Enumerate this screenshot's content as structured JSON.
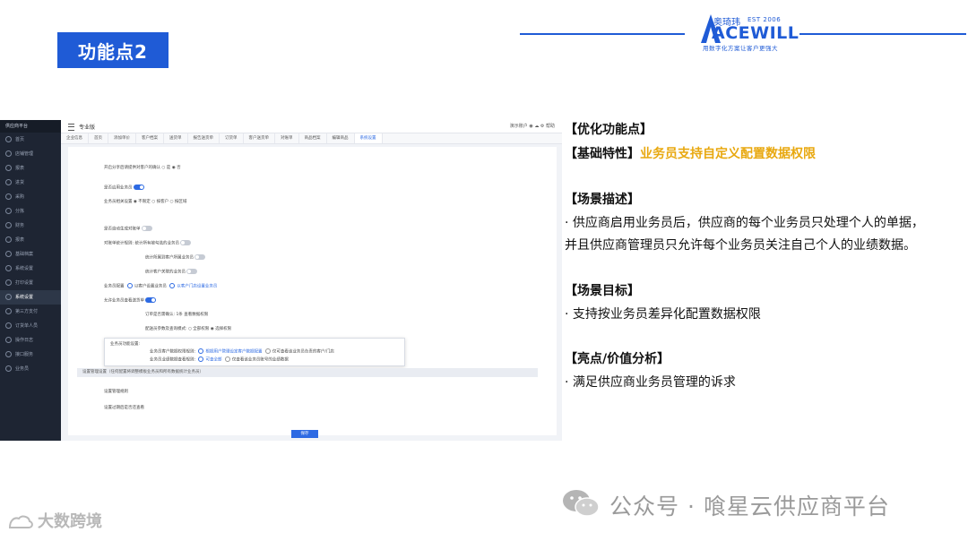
{
  "slide": {
    "title": "功能点2"
  },
  "logo": {
    "cn": "奥琦玮",
    "est": "EST 2006",
    "word": "ACEWILL",
    "tagline": "用数字化方案让客户更强大"
  },
  "screenshot": {
    "sidebar_brand": "供应商平台",
    "sidebar_items": [
      "首页",
      "店铺管理",
      "报表",
      "进货",
      "采购",
      "分拣",
      "财务",
      "报表",
      "基础档案",
      "系统设置",
      "打印设置",
      "系统设置",
      "第三方支付",
      "订货单人员",
      "操作日志",
      "接口服务",
      "业务员"
    ],
    "topbar_title": "专业版",
    "topbar_right": "演示账户 ◉ ☁ ⚙ 帮助",
    "tabs": [
      "企业信息",
      "首页",
      "添加单价",
      "客户档案",
      "送货单",
      "报告送货单",
      "订货单",
      "客户送货单",
      "对账单",
      "商品档案",
      "编辑商品",
      "系统设置"
    ],
    "rows": {
      "r1": "开启分享后请提供对客户的确认 ○ 是 ◉ 否",
      "r2": "是否启用业务员",
      "r3": "业务员相关设置  ◉ 不限定  ○ 按客户  ○ 按区域",
      "r4": "是否自动生成对账单",
      "r5": "对账单统计规则: 统计所有被勾选的业务员",
      "r6": "统计所属到客户所属业务员",
      "r7": "统计客户关联的业务员",
      "r8": "业务员配置",
      "r8b": "以客户设置业务员",
      "r8c": "以客户门店设置业务员",
      "r9": "允许业务员查看送货单",
      "r10": "订单是否需确认: 1条 查看数据权限",
      "r11": "配送员参数及查询模式: ○ 全部权限  ◉ 选择权限"
    },
    "popup": {
      "title": "业务员功能设置:",
      "row1_label": "业务员客户数据权限规则:",
      "row1_opt1": "根据用户管理设定客户数据配置",
      "row1_opt2": "仅可查看该业务员负责的客户/门店",
      "row2_label": "业务员业绩数据查看规则:",
      "row2_opt1": "可查全部",
      "row2_opt2": "仅查看该业务员账号的业绩数据"
    },
    "graybar": "设置管理设置（任何配置将调整模板业务员和所有数据统计业务员）",
    "bottom_row1": "设置管理规则",
    "bottom_row2": "设置过期后是否还查看",
    "save": "保存"
  },
  "panel": {
    "h1": "【优化功能点】",
    "h2_prefix": "【基础特性】",
    "h2_highlight": "业务员支持自定义配置数据权限",
    "h3": "【场景描述】",
    "desc1": "· 供应商启用业务员后，供应商的每个业务员只处理个人的单据，",
    "desc2": "并且供应商管理员只允许每个业务员关注自己个人的业绩数据。",
    "h4": "【场景目标】",
    "goal": "·  支持按业务员差异化配置数据权限",
    "h5": "【亮点/价值分析】",
    "value": "·   满足供应商业务员管理的诉求"
  },
  "watermark": {
    "wechat": "公众号 · 喰星云供应商平台",
    "bigdata": "大数跨境"
  }
}
